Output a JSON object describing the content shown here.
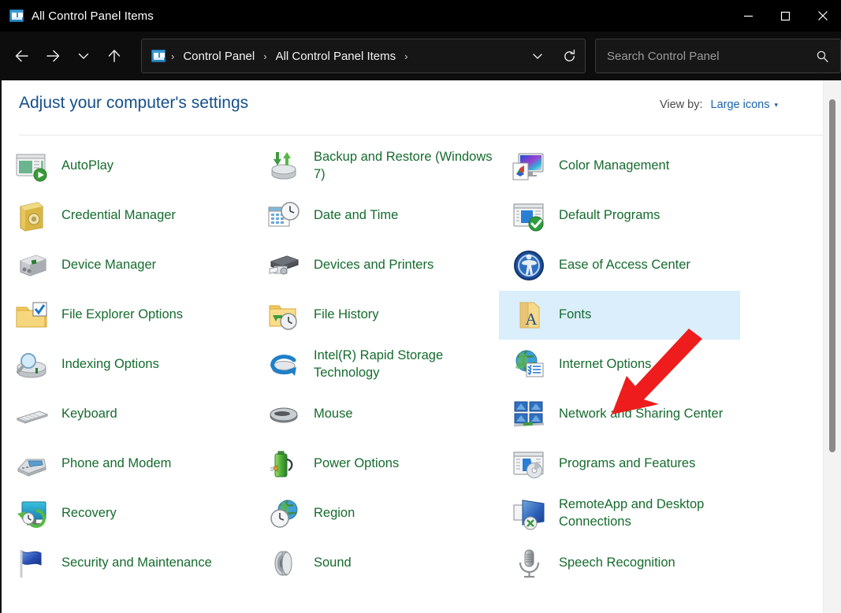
{
  "window": {
    "title": "All Control Panel Items",
    "title_icon": "control-panel-icon",
    "caption": {
      "minimize": "Minimize",
      "maximize": "Maximize",
      "close": "Close"
    }
  },
  "toolbar": {
    "back_label": "Back",
    "forward_label": "Forward",
    "recent_label": "Recent locations",
    "up_label": "Up",
    "address": {
      "icon": "control-panel-icon",
      "crumbs": [
        "Control Panel",
        "All Control Panel Items"
      ],
      "separator": "›",
      "trailing_separator": "›",
      "dropdown_label": "Previous locations",
      "refresh_label": "Refresh"
    },
    "search": {
      "placeholder": "Search Control Panel",
      "value": "",
      "icon": "search-icon"
    }
  },
  "header": {
    "page_title": "Adjust your computer's settings",
    "view_by_label": "View by:",
    "view_by_value": "Large icons",
    "view_by_caret": "▾"
  },
  "colors": {
    "title_blue": "#14508c",
    "item_green": "#156b2e",
    "link_blue": "#1a63a8",
    "selection_blue": "#daeefb",
    "annotation_red": "#ee1c1c",
    "titlebar_black": "#000000"
  },
  "items": [
    {
      "label": "AutoPlay",
      "icon": "autoplay-icon",
      "col": 0,
      "row": 0,
      "selected": false
    },
    {
      "label": "Credential Manager",
      "icon": "credential-manager-icon",
      "col": 0,
      "row": 1,
      "selected": false
    },
    {
      "label": "Device Manager",
      "icon": "device-manager-icon",
      "col": 0,
      "row": 2,
      "selected": false
    },
    {
      "label": "File Explorer Options",
      "icon": "file-explorer-options-icon",
      "col": 0,
      "row": 3,
      "selected": false
    },
    {
      "label": "Indexing Options",
      "icon": "indexing-options-icon",
      "col": 0,
      "row": 4,
      "selected": false
    },
    {
      "label": "Keyboard",
      "icon": "keyboard-icon",
      "col": 0,
      "row": 5,
      "selected": false
    },
    {
      "label": "Phone and Modem",
      "icon": "phone-and-modem-icon",
      "col": 0,
      "row": 6,
      "selected": false
    },
    {
      "label": "Recovery",
      "icon": "recovery-icon",
      "col": 0,
      "row": 7,
      "selected": false
    },
    {
      "label": "Security and Maintenance",
      "icon": "security-maintenance-icon",
      "col": 0,
      "row": 8,
      "selected": false
    },
    {
      "label": "Backup and Restore (Windows 7)",
      "icon": "backup-restore-icon",
      "col": 1,
      "row": 0,
      "selected": false
    },
    {
      "label": "Date and Time",
      "icon": "date-and-time-icon",
      "col": 1,
      "row": 1,
      "selected": false
    },
    {
      "label": "Devices and Printers",
      "icon": "devices-printers-icon",
      "col": 1,
      "row": 2,
      "selected": false
    },
    {
      "label": "File History",
      "icon": "file-history-icon",
      "col": 1,
      "row": 3,
      "selected": false
    },
    {
      "label": "Intel(R) Rapid Storage Technology",
      "icon": "intel-rst-icon",
      "col": 1,
      "row": 4,
      "selected": false
    },
    {
      "label": "Mouse",
      "icon": "mouse-icon",
      "col": 1,
      "row": 5,
      "selected": false
    },
    {
      "label": "Power Options",
      "icon": "power-options-icon",
      "col": 1,
      "row": 6,
      "selected": false
    },
    {
      "label": "Region",
      "icon": "region-icon",
      "col": 1,
      "row": 7,
      "selected": false
    },
    {
      "label": "Sound",
      "icon": "sound-icon",
      "col": 1,
      "row": 8,
      "selected": false
    },
    {
      "label": "Color Management",
      "icon": "color-management-icon",
      "col": 2,
      "row": 0,
      "selected": false
    },
    {
      "label": "Default Programs",
      "icon": "default-programs-icon",
      "col": 2,
      "row": 1,
      "selected": false
    },
    {
      "label": "Ease of Access Center",
      "icon": "ease-of-access-icon",
      "col": 2,
      "row": 2,
      "selected": false
    },
    {
      "label": "Fonts",
      "icon": "fonts-icon",
      "col": 2,
      "row": 3,
      "selected": true
    },
    {
      "label": "Internet Options",
      "icon": "internet-options-icon",
      "col": 2,
      "row": 4,
      "selected": false
    },
    {
      "label": "Network and Sharing Center",
      "icon": "network-sharing-icon",
      "col": 2,
      "row": 5,
      "selected": false
    },
    {
      "label": "Programs and Features",
      "icon": "programs-features-icon",
      "col": 2,
      "row": 6,
      "selected": false
    },
    {
      "label": "RemoteApp and Desktop Connections",
      "icon": "remoteapp-icon",
      "col": 2,
      "row": 7,
      "selected": false
    },
    {
      "label": "Speech Recognition",
      "icon": "speech-recognition-icon",
      "col": 2,
      "row": 8,
      "selected": false
    }
  ],
  "annotation": {
    "type": "arrow",
    "color": "#ee1c1c",
    "points_to": "Fonts"
  },
  "scrollbar": {
    "orientation": "vertical",
    "thumb_position_pct": 4,
    "thumb_size_pct": 66
  }
}
